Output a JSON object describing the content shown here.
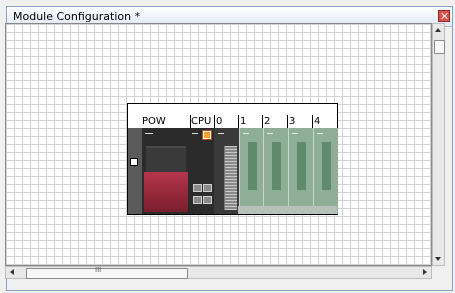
{
  "window": {
    "title": "Module Configuration *"
  },
  "base_unit": {
    "slot_labels": [
      "POW",
      "CPU",
      "0",
      "1",
      "2",
      "3",
      "4"
    ]
  },
  "colors": {
    "power_module": "#8e2a3a",
    "cpu_led": "#f2a52a",
    "io_module": "#8fae98",
    "grid_line": "#d3d3d3",
    "title_bar": "#dfe8f5"
  },
  "icons": {
    "close": "close-icon",
    "scroll_up": "arrow-up-icon",
    "scroll_down": "arrow-down-icon",
    "scroll_left": "arrow-left-icon",
    "scroll_right": "arrow-right-icon",
    "grip": "grip-icon"
  },
  "scrollbar": {
    "grip_text": "III"
  }
}
